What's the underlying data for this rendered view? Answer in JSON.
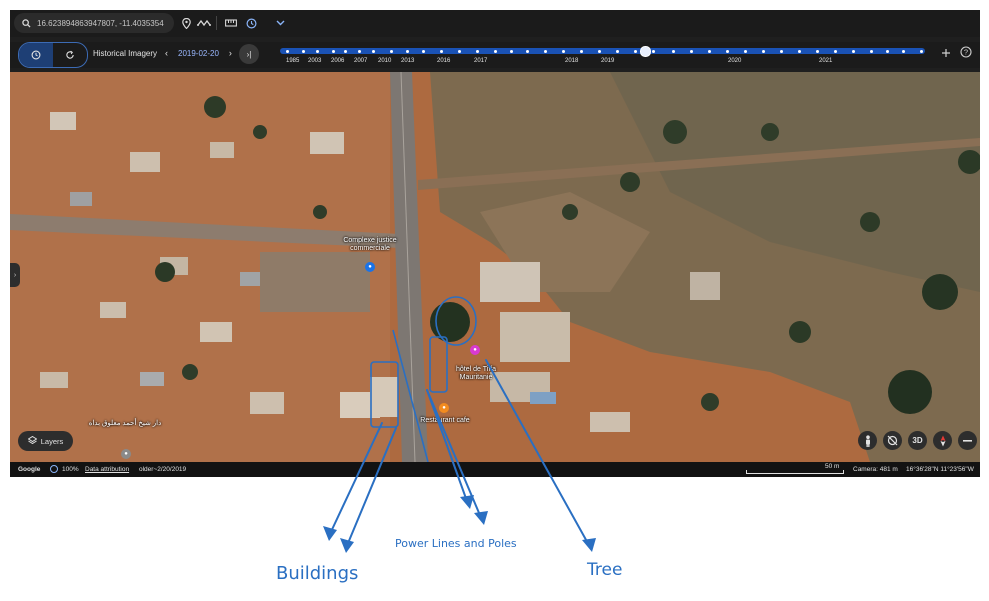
{
  "search": {
    "coordinates": "16.623894863947807, -11.4035354"
  },
  "toolbar_icons": [
    "search-icon",
    "pin-icon",
    "path-icon",
    "ruler-icon",
    "history-icon",
    "chevron-down-icon"
  ],
  "historical": {
    "label": "Historical Imagery",
    "date": "2019-02-20",
    "prev": "‹",
    "next": "›",
    "skip": "›|",
    "years": [
      "1985",
      "2003",
      "2006",
      "2007",
      "2010",
      "2013",
      "2016",
      "2017",
      "2018",
      "2019",
      "2020",
      "2021"
    ]
  },
  "map": {
    "poi": {
      "complexe": "Complexe justice commerciale",
      "hotel": "hôtel de Tiffa Mauritanie",
      "restaurant": "Restaurant cafe",
      "arabic": "دار شيخ أحمد معلوق بداه"
    }
  },
  "controls": {
    "layers": "Layers",
    "three_d": "3D"
  },
  "status": {
    "google": "Google",
    "zoom": "100%",
    "attribution": "Data attribution",
    "older": "older~2/20/2019",
    "scale": "50 m",
    "camera": "Camera: 481 m",
    "coords": "16°36'28\"N 11°23'56\"W"
  },
  "annotations": {
    "buildings": "Buildings",
    "power": "Power Lines and Poles",
    "tree": "Tree"
  },
  "colors": {
    "annotation": "#2a6fc2",
    "timeline": "#1a52b5",
    "accent": "#9ab8ff"
  }
}
